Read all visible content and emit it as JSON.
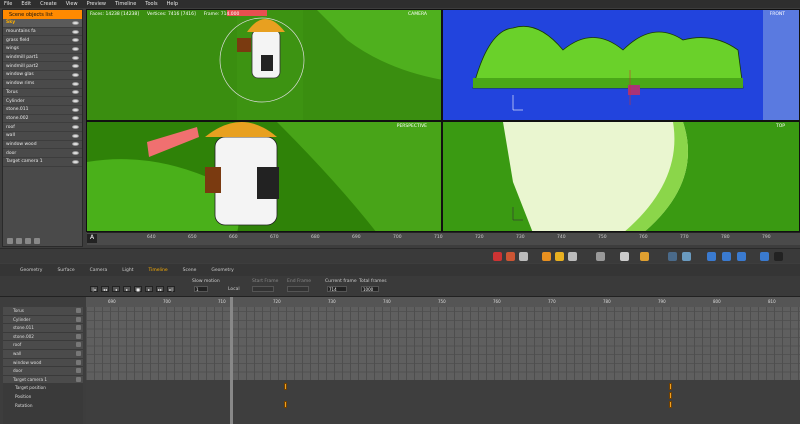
{
  "menu": [
    "File",
    "Edit",
    "Create",
    "View",
    "Preview",
    "Timeline",
    "Tools",
    "Help"
  ],
  "sidebar": {
    "title": "Scene objects list",
    "items": [
      "Sky",
      "mountains fa",
      "grass field",
      "wings",
      "windmill part1",
      "windmill part2",
      "window glas",
      "window rims",
      "Torus",
      "Cylinder",
      "stone.011",
      "stone.002",
      "roof",
      "wall",
      "window wood",
      "door",
      "Target camera 1"
    ]
  },
  "viewports": {
    "camera": "CAMERA",
    "front": "FRONT",
    "perspective": "PERSPECTIVE",
    "top": "TOP"
  },
  "stats": {
    "faces": "Faces: 14238 [14238]",
    "vertices": "Vertices: 7416 [7416]",
    "frame": "Frame: 714.000"
  },
  "ruler": [
    "640",
    "650",
    "660",
    "670",
    "680",
    "690",
    "700",
    "710",
    "720",
    "730",
    "740",
    "750",
    "760",
    "770",
    "780",
    "790"
  ],
  "tabs": [
    "Geometry",
    "Surface",
    "Camera",
    "Light",
    "Timeline",
    "Scene",
    "Geometry"
  ],
  "active_tab": "Timeline",
  "panel": {
    "slow_motion": "Slow motion",
    "slow_value": "1",
    "local": "Local",
    "start_frame": "Start Frame",
    "end_frame": "End Frame",
    "current_frame": "Current frame",
    "current_value": "714",
    "total_frames": "Total frames",
    "total_value": "1000"
  },
  "timeline_ruler": [
    "690",
    "700",
    "710",
    "720",
    "730",
    "740",
    "750",
    "760",
    "770",
    "780",
    "790",
    "800",
    "810"
  ],
  "tracks": [
    "Torus",
    "Cylinder",
    "stone.011",
    "stone.002",
    "roof",
    "wall",
    "window wood",
    "door",
    "Target camera 1",
    "Target position",
    "Position",
    "Rotation"
  ],
  "colors": {
    "accent": "#ff8a00",
    "grass": "#3a9a12",
    "sky_blue": "#2244dd"
  },
  "icons": [
    "move-icon",
    "rotate-icon",
    "scale-icon",
    "camera-icon",
    "light-icon",
    "render-icon"
  ]
}
